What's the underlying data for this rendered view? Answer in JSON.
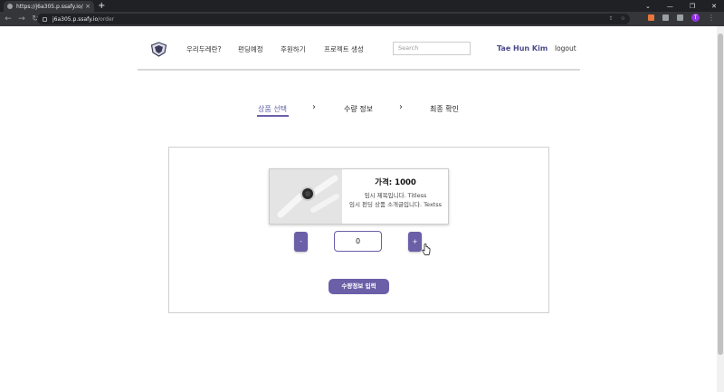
{
  "browser": {
    "tab_title": "https://j6a305.p.ssafy.io/order",
    "new_tab": "+",
    "url_host": "j6a305.p.ssafy.io",
    "url_path": "/order",
    "avatar_letter": "T"
  },
  "nav": {
    "items": [
      "우리두레란?",
      "펀딩예정",
      "후원하기",
      "프로젝트 생성"
    ],
    "search_placeholder": "Search",
    "user_name": "Tae Hun Kim",
    "logout": "logout"
  },
  "steps": {
    "items": [
      "상품 선택",
      "수량 정보",
      "최종 확인"
    ],
    "active_index": 0
  },
  "product": {
    "price_text": "가격: 1000",
    "description_line1": "임시 제목입니다. Titless",
    "description_line2": "임시 펀딩 상품 소개글입니다. Textss"
  },
  "quantity": {
    "minus_label": "-",
    "value": "0",
    "plus_label": "+"
  },
  "submit_label": "수량정보 입력",
  "colors": {
    "accent": "#6b5fa8",
    "user_name": "#4a4a8a",
    "chrome_dark": "#202124"
  }
}
